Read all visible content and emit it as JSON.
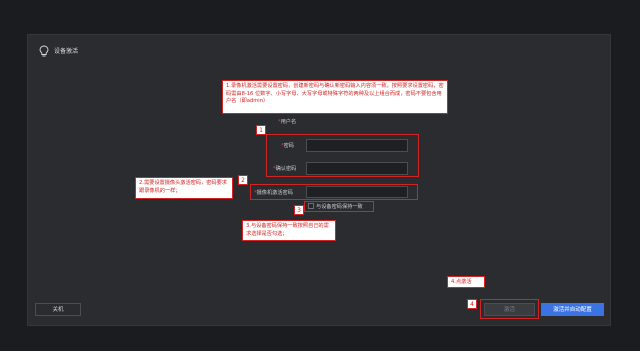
{
  "page": {
    "title": "设备激活"
  },
  "annotations": {
    "note1": "1.录像机激活需要设置密码，创建新密码与确认新密码输入内容须一致。按照要求设置密码，密码需由8-16 位数字、小写字母、大写字母或特殊字符的两种及以上组合而成，密码不要包含用户名（即admin）",
    "note2": "2.需要设置摄像头激活密码，密码要求跟录像机的一样；",
    "note3": "3.与设备密码保持一致按照自己的需求选择是否勾选；",
    "note4": "4.点激活",
    "num1": "1",
    "num2": "2",
    "num3": "3",
    "num4": "4"
  },
  "form": {
    "username_label": "用户名",
    "password_label": "密码",
    "confirm_label": "确认密码",
    "camera_password_label": "摄像机激活密码",
    "required_mark": "*",
    "sync_checkbox_label": "与设备密码保持一致"
  },
  "buttons": {
    "shutdown": "关机",
    "activate": "激活",
    "activate_auto_config": "激活并自动配置"
  },
  "colors": {
    "accent": "#3c73e3",
    "annotation_red": "#d32323",
    "background": "#1b1c1f",
    "panel": "#2a2c30"
  }
}
